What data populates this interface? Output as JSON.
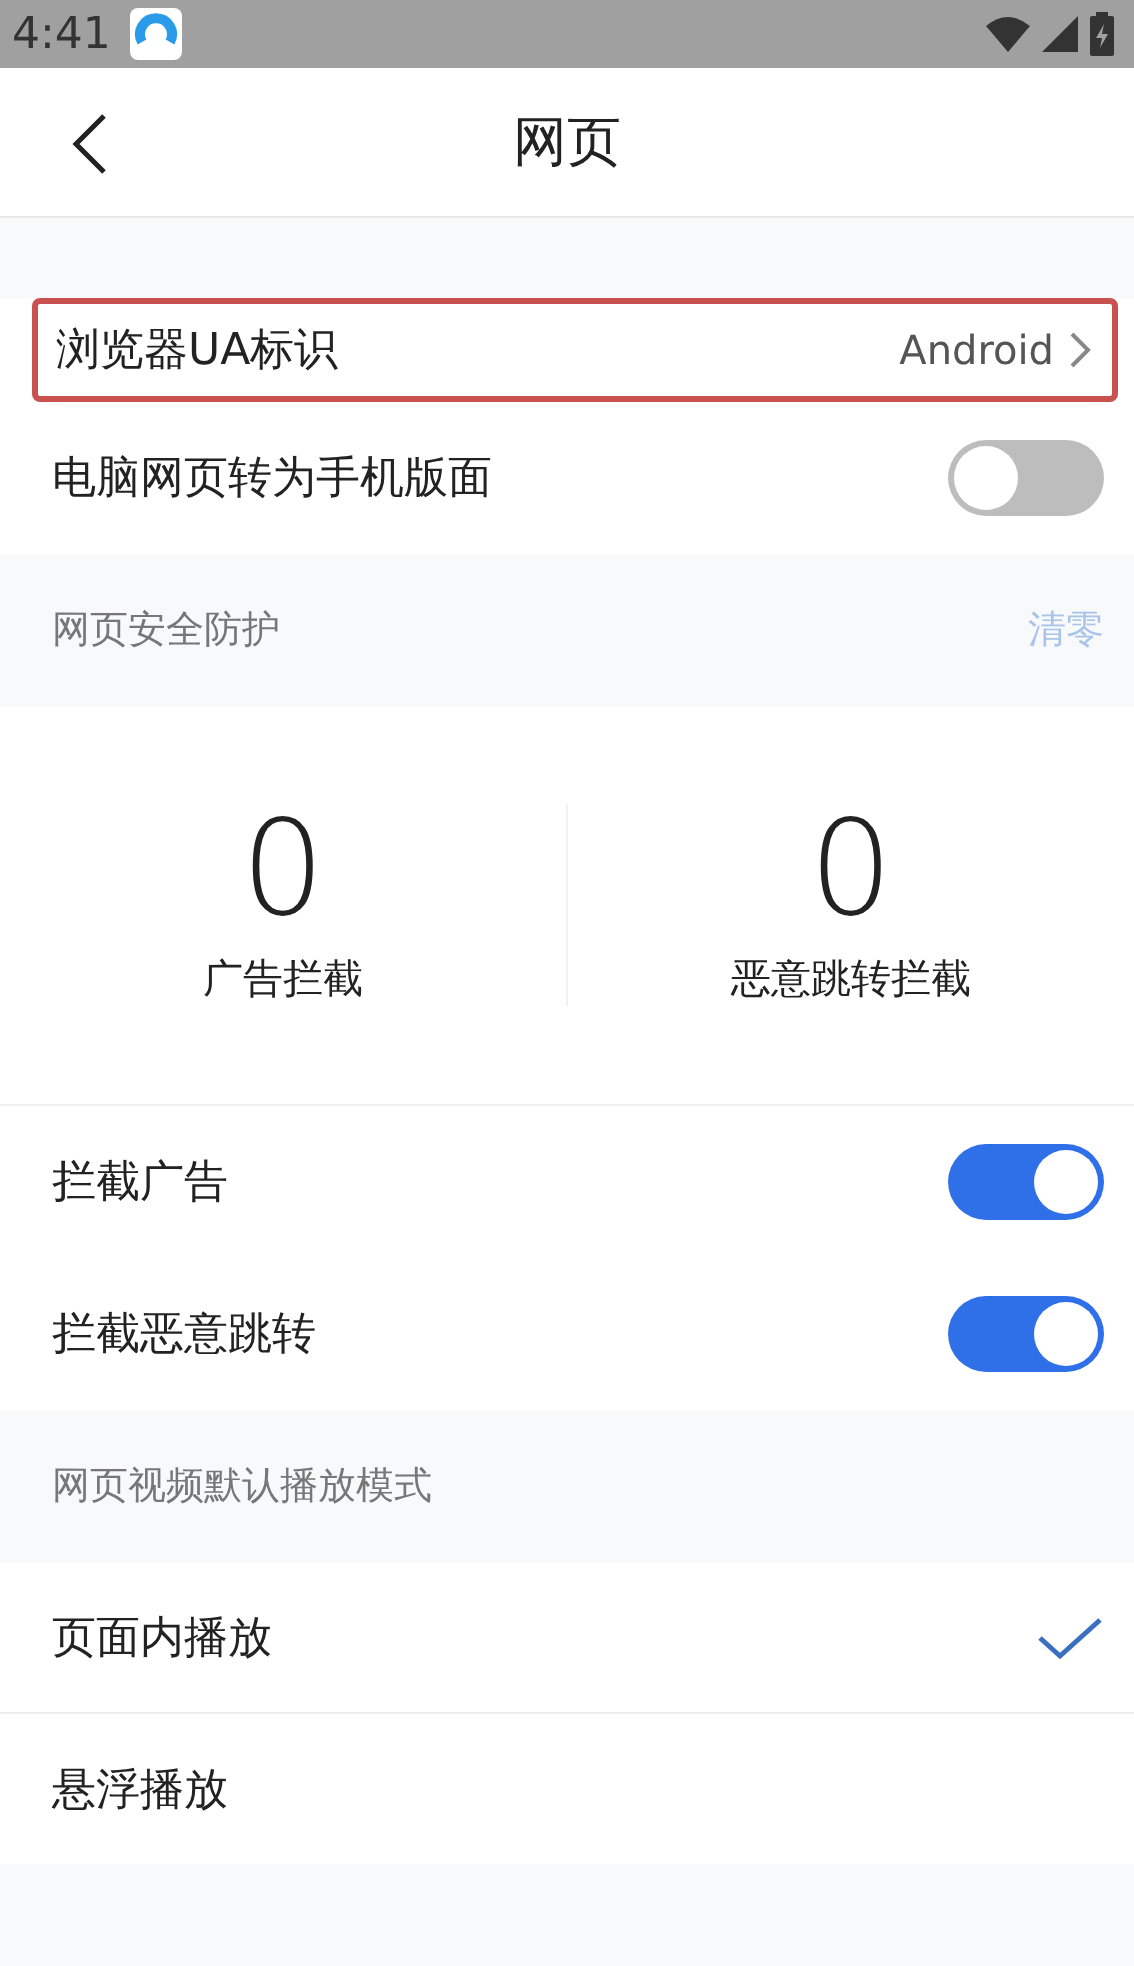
{
  "status_bar": {
    "time": "4:41"
  },
  "header": {
    "title": "网页"
  },
  "general": [
    {
      "kind": "link",
      "label": "浏览器UA标识",
      "value": "Android",
      "highlighted": true
    },
    {
      "kind": "toggle",
      "label": "电脑网页转为手机版面",
      "on": false
    }
  ],
  "security": {
    "title": "网页安全防护",
    "action": "清零",
    "stats": [
      {
        "value": "0",
        "label": "广告拦截"
      },
      {
        "value": "0",
        "label": "恶意跳转拦截"
      }
    ],
    "items": [
      {
        "kind": "toggle",
        "label": "拦截广告",
        "on": true
      },
      {
        "kind": "toggle",
        "label": "拦截恶意跳转",
        "on": true
      }
    ]
  },
  "video": {
    "title": "网页视频默认播放模式",
    "options": [
      {
        "label": "页面内播放",
        "selected": true
      },
      {
        "label": "悬浮播放",
        "selected": false
      }
    ]
  }
}
